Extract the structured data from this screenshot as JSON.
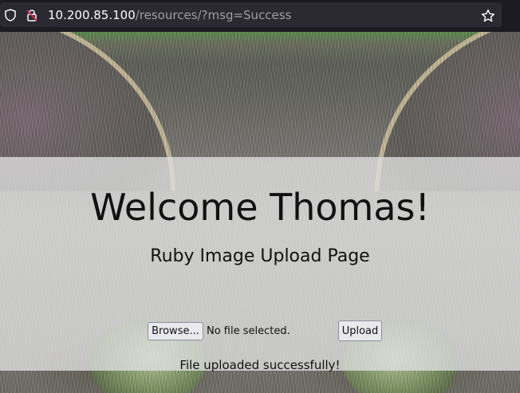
{
  "browser": {
    "url_host": "10.200.85.100",
    "url_path": "/resources/?msg=Success",
    "icons": {
      "shield": "shield-icon",
      "lock": "lock-warning-icon",
      "bookmark": "star-icon"
    },
    "colors": {
      "toolbar_bg": "#1c1b22",
      "field_bg": "#2b2a33",
      "lock_slash": "#e22850"
    }
  },
  "page": {
    "title": "Welcome Thomas!",
    "subtitle": "Ruby Image Upload Page",
    "file_input": {
      "browse_label": "Browse...",
      "status": "No file selected."
    },
    "upload_label": "Upload",
    "message": "File uploaded successfully!"
  }
}
